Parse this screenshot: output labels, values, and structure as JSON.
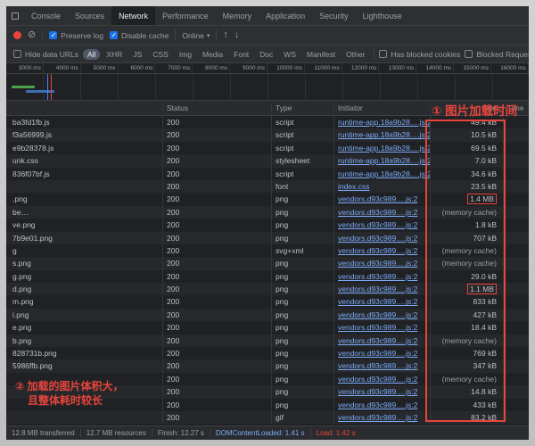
{
  "tabbar": {
    "tabs": [
      {
        "label": "Console",
        "active": false
      },
      {
        "label": "Sources",
        "active": false
      },
      {
        "label": "Network",
        "active": true
      },
      {
        "label": "Performance",
        "active": false
      },
      {
        "label": "Memory",
        "active": false
      },
      {
        "label": "Application",
        "active": false
      },
      {
        "label": "Security",
        "active": false
      },
      {
        "label": "Lighthouse",
        "active": false
      }
    ]
  },
  "toolbar": {
    "preserve_log_label": "Preserve log",
    "preserve_log_checked": true,
    "disable_cache_label": "Disable cache",
    "disable_cache_checked": true,
    "throttling_value": "Online",
    "import_icon": "import-har",
    "export_icon": "export-har"
  },
  "filter_bar": {
    "hide_data_urls_label": "Hide data URLs",
    "hide_data_urls_checked": false,
    "filters": [
      "All",
      "XHR",
      "JS",
      "CSS",
      "Img",
      "Media",
      "Font",
      "Doc",
      "WS",
      "Manifest",
      "Other"
    ],
    "active_filter": "All",
    "has_blocked_cookies_label": "Has blocked cookies",
    "blocked_requests_label": "Blocked Requests"
  },
  "timeline": {
    "ticks": [
      "3000 ms",
      "4000 ms",
      "5000 ms",
      "6000 ms",
      "7000 ms",
      "8000 ms",
      "9000 ms",
      "10000 ms",
      "11000 ms",
      "12000 ms",
      "13000 ms",
      "14000 ms",
      "15000 ms",
      "16000 ms"
    ]
  },
  "annotations": {
    "one": "① 图片加载时间",
    "two_line1": "② 加载的图片体积大，",
    "two_line2": "且整体耗时较长",
    "color": "#e8453c"
  },
  "table": {
    "headers": {
      "name": "",
      "status": "Status",
      "type": "Type",
      "initiator": "Initiator",
      "size": "Size",
      "time": "Time"
    },
    "rows": [
      {
        "name": "ba3fd1fb.js",
        "status": "200",
        "type": "script",
        "initiator": "runtime-app.18a9b28….js:2",
        "size": "49.4 kB"
      },
      {
        "name": "f3a56999.js",
        "status": "200",
        "type": "script",
        "initiator": "runtime-app.18a9b28….js:2",
        "size": "10.5 kB"
      },
      {
        "name": "e9b28378.js",
        "status": "200",
        "type": "script",
        "initiator": "runtime-app.18a9b28….js:2",
        "size": "69.5 kB"
      },
      {
        "name": "unk.css",
        "status": "200",
        "type": "stylesheet",
        "initiator": "runtime-app.18a9b28….js:2",
        "size": "7.0 kB"
      },
      {
        "name": "836f07bf.js",
        "status": "200",
        "type": "script",
        "initiator": "runtime-app.18a9b28….js:2",
        "size": "34.6 kB"
      },
      {
        "name": "",
        "status": "200",
        "type": "font",
        "initiator": "index.css",
        "size": "23.5 kB"
      },
      {
        "name": ".png",
        "status": "200",
        "type": "png",
        "initiator": "vendors.d93c989….js:2",
        "size": "1.4 MB",
        "size_boxed": true
      },
      {
        "name": "be…",
        "status": "200",
        "type": "png",
        "initiator": "vendors.d93c989….js:2",
        "size": "(memory cache)"
      },
      {
        "name": "ve.png",
        "status": "200",
        "type": "png",
        "initiator": "vendors.d93c989….js:2",
        "size": "1.8 kB"
      },
      {
        "name": "7b9e01.png",
        "status": "200",
        "type": "png",
        "initiator": "vendors.d93c989….js:2",
        "size": "707 kB"
      },
      {
        "name": "g",
        "status": "200",
        "type": "svg+xml",
        "initiator": "vendors.d93c989….js:2",
        "size": "(memory cache)"
      },
      {
        "name": "s.png",
        "status": "200",
        "type": "png",
        "initiator": "vendors.d93c989….js:2",
        "size": "(memory cache)"
      },
      {
        "name": "g.png",
        "status": "200",
        "type": "png",
        "initiator": "vendors.d93c989….js:2",
        "size": "29.0 kB"
      },
      {
        "name": "d.png",
        "status": "200",
        "type": "png",
        "initiator": "vendors.d93c989….js:2",
        "size": "1.1 MB",
        "size_boxed": true
      },
      {
        "name": "m.png",
        "status": "200",
        "type": "png",
        "initiator": "vendors.d93c989….js:2",
        "size": "833 kB"
      },
      {
        "name": "i.png",
        "status": "200",
        "type": "png",
        "initiator": "vendors.d93c989….js:2",
        "size": "427 kB"
      },
      {
        "name": "e.png",
        "status": "200",
        "type": "png",
        "initiator": "vendors.d93c989….js:2",
        "size": "18.4 kB"
      },
      {
        "name": "b.png",
        "status": "200",
        "type": "png",
        "initiator": "vendors.d93c989….js:2",
        "size": "(memory cache)"
      },
      {
        "name": "828731b.png",
        "status": "200",
        "type": "png",
        "initiator": "vendors.d93c989….js:2",
        "size": "769 kB"
      },
      {
        "name": "5986ffb.png",
        "status": "200",
        "type": "png",
        "initiator": "vendors.d93c989….js:2",
        "size": "347 kB"
      },
      {
        "name": "",
        "status": "200",
        "type": "png",
        "initiator": "vendors.d93c989….js:2",
        "size": "(memory cache)"
      },
      {
        "name": "",
        "status": "200",
        "type": "png",
        "initiator": "vendors.d93c989….js:2",
        "size": "14.8 kB"
      },
      {
        "name": "",
        "status": "200",
        "type": "png",
        "initiator": "vendors.d93c989….js:2",
        "size": "433 kB"
      },
      {
        "name": "",
        "status": "200",
        "type": "gif",
        "initiator": "vendors.d93c989….js:2",
        "size": "83.2 kB"
      }
    ]
  },
  "status_bar": {
    "items": [
      {
        "text": "12.8 MB transferred"
      },
      {
        "text": "12.7 MB resources"
      },
      {
        "text": "Finish: 12.27 s"
      },
      {
        "text": "DOMContentLoaded: 1.41 s",
        "accent": "#7cacf8"
      },
      {
        "text": "Load: 1.42 s",
        "accent": "#e8453c"
      }
    ]
  }
}
